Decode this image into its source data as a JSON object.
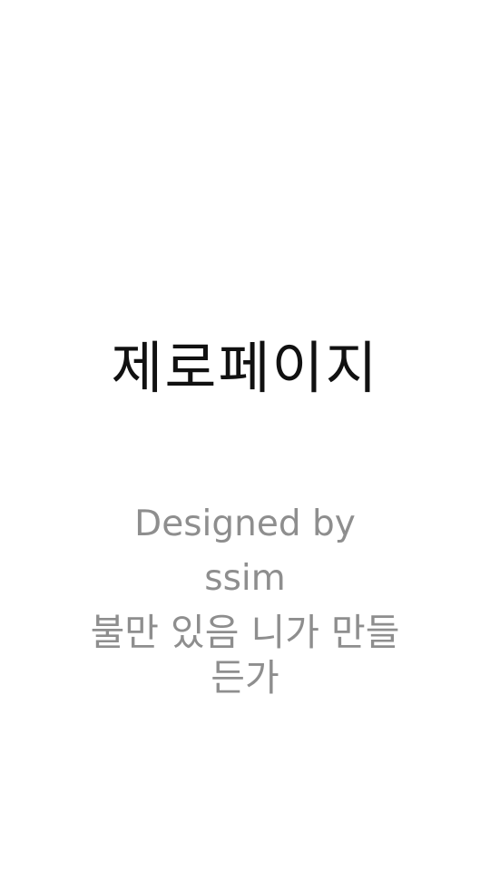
{
  "app": {
    "title": "제로페이지"
  },
  "credits": {
    "designed_by_label": "Designed by",
    "designer": "ssim",
    "tagline": "불만 있음 니가 만들든가"
  },
  "colors": {
    "background": "#ffffff",
    "title": "#111111",
    "credits": "#8e8e8e"
  }
}
